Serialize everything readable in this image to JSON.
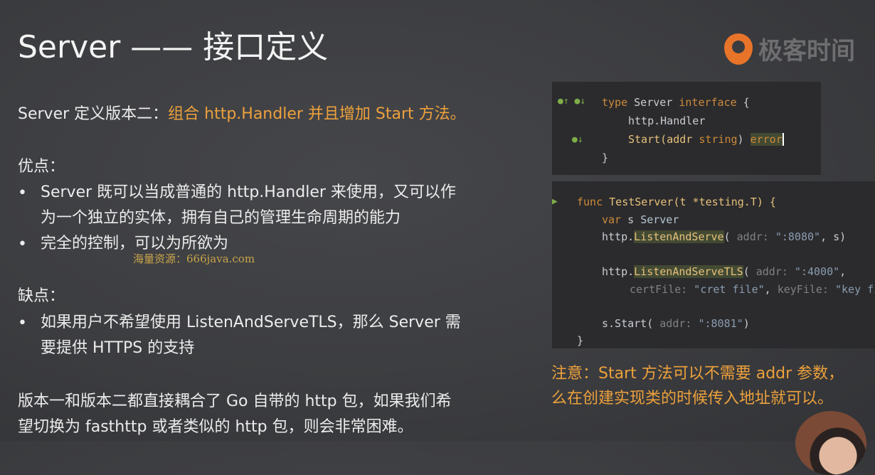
{
  "title": "Server —— 接口定义",
  "logo": {
    "text": "极客时间",
    "color": "#e8742a"
  },
  "intro": {
    "prefix": "Server 定义版本二：",
    "highlight": "组合 http.Handler 并且增加 Start 方法。"
  },
  "pros": {
    "heading": "优点：",
    "items": [
      "Server 既可以当成普通的 http.Handler 来使用，又可以作",
      "为一个独立的实体，拥有自己的管理生命周期的能力",
      "完全的控制，可以为所欲为"
    ]
  },
  "watermark": "海量资源：666java.com",
  "cons": {
    "heading": "缺点：",
    "items": [
      "如果用户不希望使用 ListenAndServeTLS，那么 Server 需",
      "要提供 HTTPS 的支持"
    ]
  },
  "conclusion": [
    "版本一和版本二都直接耦合了 Go 自带的 http 包，如果我们希",
    "望切换为 fasthttp 或者类似的 http 包，则会非常困难。"
  ],
  "bullet": "•",
  "code1": {
    "l1": [
      "type",
      " Server ",
      "interface",
      " {"
    ],
    "l2": "http.Handler",
    "l3": [
      "Start(addr ",
      "string",
      ") ",
      "error"
    ],
    "l4": "}"
  },
  "code2": {
    "l1": [
      "func",
      " TestServer(t *testing.T) {"
    ],
    "l2": [
      "var",
      " s ",
      "Server"
    ],
    "l3": [
      "http.",
      "ListenAndServe",
      "( ",
      "addr:",
      " \":8080\"",
      ", s)"
    ],
    "l4": [
      "http.",
      "ListenAndServeTLS",
      "( ",
      "addr:",
      " \":4000\"",
      ","
    ],
    "l5": [
      "certFile:",
      " \"cret file\"",
      ", ",
      "keyFile:",
      " \"key fil"
    ],
    "l6": [
      "s.Start( ",
      "addr:",
      " \":8081\"",
      ")"
    ],
    "l7": "}"
  },
  "note": [
    "注意：Start 方法可以不需要 addr 参数，",
    "么在创建实现类的时候传入地址就可以。"
  ],
  "colors": {
    "accent": "#eda13c",
    "background": "#3b3c3f",
    "code_bg": "#2b2b2d"
  }
}
